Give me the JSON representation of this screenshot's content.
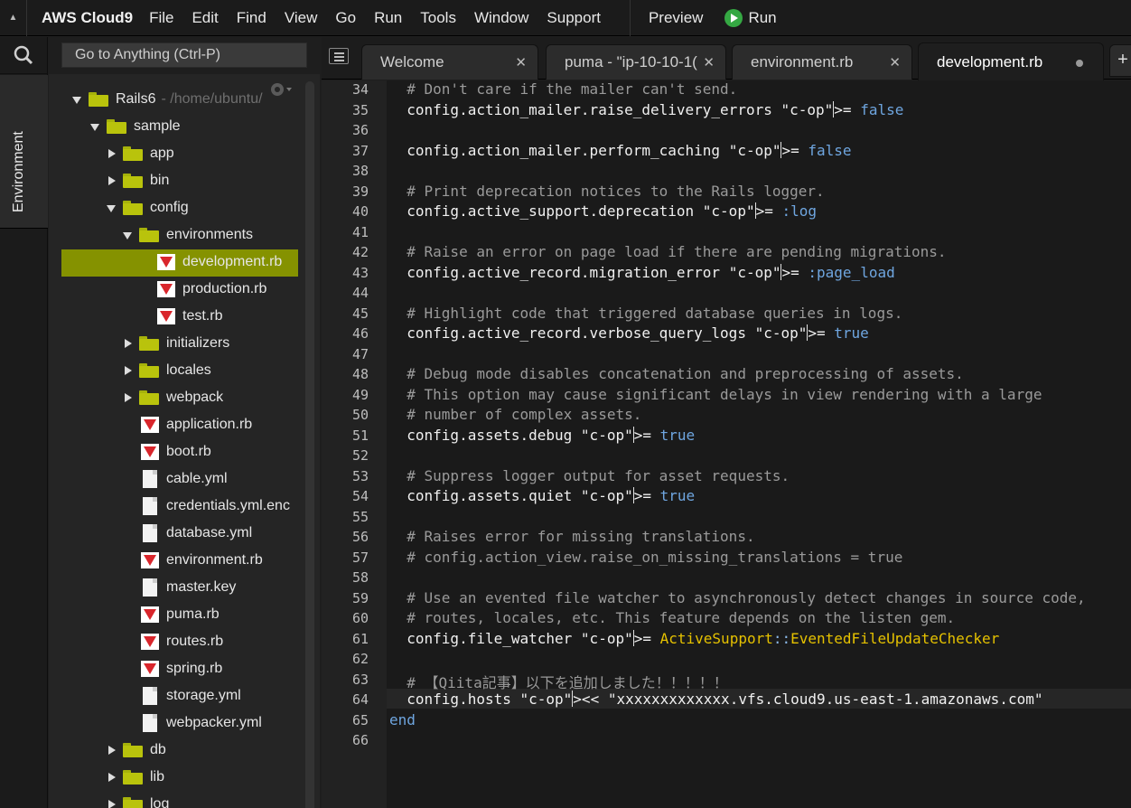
{
  "menubar": {
    "brand": "AWS Cloud9",
    "items": [
      "File",
      "Edit",
      "Find",
      "View",
      "Go",
      "Run",
      "Tools",
      "Window",
      "Support"
    ],
    "preview": "Preview",
    "run": "Run"
  },
  "sidebar": {
    "env_tab": "Environment",
    "goto_placeholder": "Go to Anything (Ctrl-P)"
  },
  "tree": {
    "root_name": "Rails6",
    "root_path": "- /home/ubuntu/",
    "nodes": [
      {
        "label": "sample",
        "kind": "folder",
        "expanded": true
      },
      {
        "label": "app",
        "kind": "folder",
        "expanded": false
      },
      {
        "label": "bin",
        "kind": "folder",
        "expanded": false
      },
      {
        "label": "config",
        "kind": "folder",
        "expanded": true
      },
      {
        "label": "environments",
        "kind": "folder",
        "expanded": true
      },
      {
        "label": "development.rb",
        "kind": "ruby",
        "selected": true
      },
      {
        "label": "production.rb",
        "kind": "ruby"
      },
      {
        "label": "test.rb",
        "kind": "ruby"
      },
      {
        "label": "initializers",
        "kind": "folder",
        "expanded": false
      },
      {
        "label": "locales",
        "kind": "folder",
        "expanded": false
      },
      {
        "label": "webpack",
        "kind": "folder",
        "expanded": false
      },
      {
        "label": "application.rb",
        "kind": "ruby"
      },
      {
        "label": "boot.rb",
        "kind": "ruby"
      },
      {
        "label": "cable.yml",
        "kind": "file"
      },
      {
        "label": "credentials.yml.enc",
        "kind": "file"
      },
      {
        "label": "database.yml",
        "kind": "file"
      },
      {
        "label": "environment.rb",
        "kind": "ruby"
      },
      {
        "label": "master.key",
        "kind": "file"
      },
      {
        "label": "puma.rb",
        "kind": "ruby"
      },
      {
        "label": "routes.rb",
        "kind": "ruby"
      },
      {
        "label": "spring.rb",
        "kind": "ruby"
      },
      {
        "label": "storage.yml",
        "kind": "file"
      },
      {
        "label": "webpacker.yml",
        "kind": "file"
      },
      {
        "label": "db",
        "kind": "folder",
        "expanded": false
      },
      {
        "label": "lib",
        "kind": "folder",
        "expanded": false
      },
      {
        "label": "log",
        "kind": "folder",
        "expanded": false
      }
    ]
  },
  "tabs": [
    {
      "label": "Welcome",
      "active": false
    },
    {
      "label": "puma - \"ip-10-10-1(",
      "active": false
    },
    {
      "label": "environment.rb",
      "active": false
    },
    {
      "label": "development.rb",
      "active": true,
      "unsaved": true
    }
  ],
  "tab_plus": "+",
  "editor": {
    "lines": [
      {
        "n": "34",
        "code": "  # Don't care if the mailer can't send."
      },
      {
        "n": "35",
        "code": "  config.action_mailer.raise_delivery_errors = false"
      },
      {
        "n": "36",
        "code": ""
      },
      {
        "n": "37",
        "code": "  config.action_mailer.perform_caching = false"
      },
      {
        "n": "38",
        "code": ""
      },
      {
        "n": "39",
        "code": "  # Print deprecation notices to the Rails logger."
      },
      {
        "n": "40",
        "code": "  config.active_support.deprecation = :log"
      },
      {
        "n": "41",
        "code": ""
      },
      {
        "n": "42",
        "code": "  # Raise an error on page load if there are pending migrations."
      },
      {
        "n": "43",
        "code": "  config.active_record.migration_error = :page_load"
      },
      {
        "n": "44",
        "code": ""
      },
      {
        "n": "45",
        "code": "  # Highlight code that triggered database queries in logs."
      },
      {
        "n": "46",
        "code": "  config.active_record.verbose_query_logs = true"
      },
      {
        "n": "47",
        "code": ""
      },
      {
        "n": "48",
        "code": "  # Debug mode disables concatenation and preprocessing of assets."
      },
      {
        "n": "49",
        "code": "  # This option may cause significant delays in view rendering with a large"
      },
      {
        "n": "50",
        "code": "  # number of complex assets."
      },
      {
        "n": "51",
        "code": "  config.assets.debug = true"
      },
      {
        "n": "52",
        "code": ""
      },
      {
        "n": "53",
        "code": "  # Suppress logger output for asset requests."
      },
      {
        "n": "54",
        "code": "  config.assets.quiet = true"
      },
      {
        "n": "55",
        "code": ""
      },
      {
        "n": "56",
        "code": "  # Raises error for missing translations."
      },
      {
        "n": "57",
        "code": "  # config.action_view.raise_on_missing_translations = true"
      },
      {
        "n": "58",
        "code": ""
      },
      {
        "n": "59",
        "code": "  # Use an evented file watcher to asynchronously detect changes in source code,"
      },
      {
        "n": "60",
        "code": "  # routes, locales, etc. This feature depends on the listen gem."
      },
      {
        "n": "61",
        "code": "  config.file_watcher = ActiveSupport::EventedFileUpdateChecker"
      },
      {
        "n": "62",
        "code": ""
      },
      {
        "n": "63",
        "code": "  # 【Qiita記事】以下を追加しました！！！！！"
      },
      {
        "n": "64",
        "code": "  config.hosts << \"xxxxxxxxxxxxx.vfs.cloud9.us-east-1.amazonaws.com\""
      },
      {
        "n": "65",
        "code": "end"
      },
      {
        "n": "66",
        "code": ""
      }
    ]
  }
}
